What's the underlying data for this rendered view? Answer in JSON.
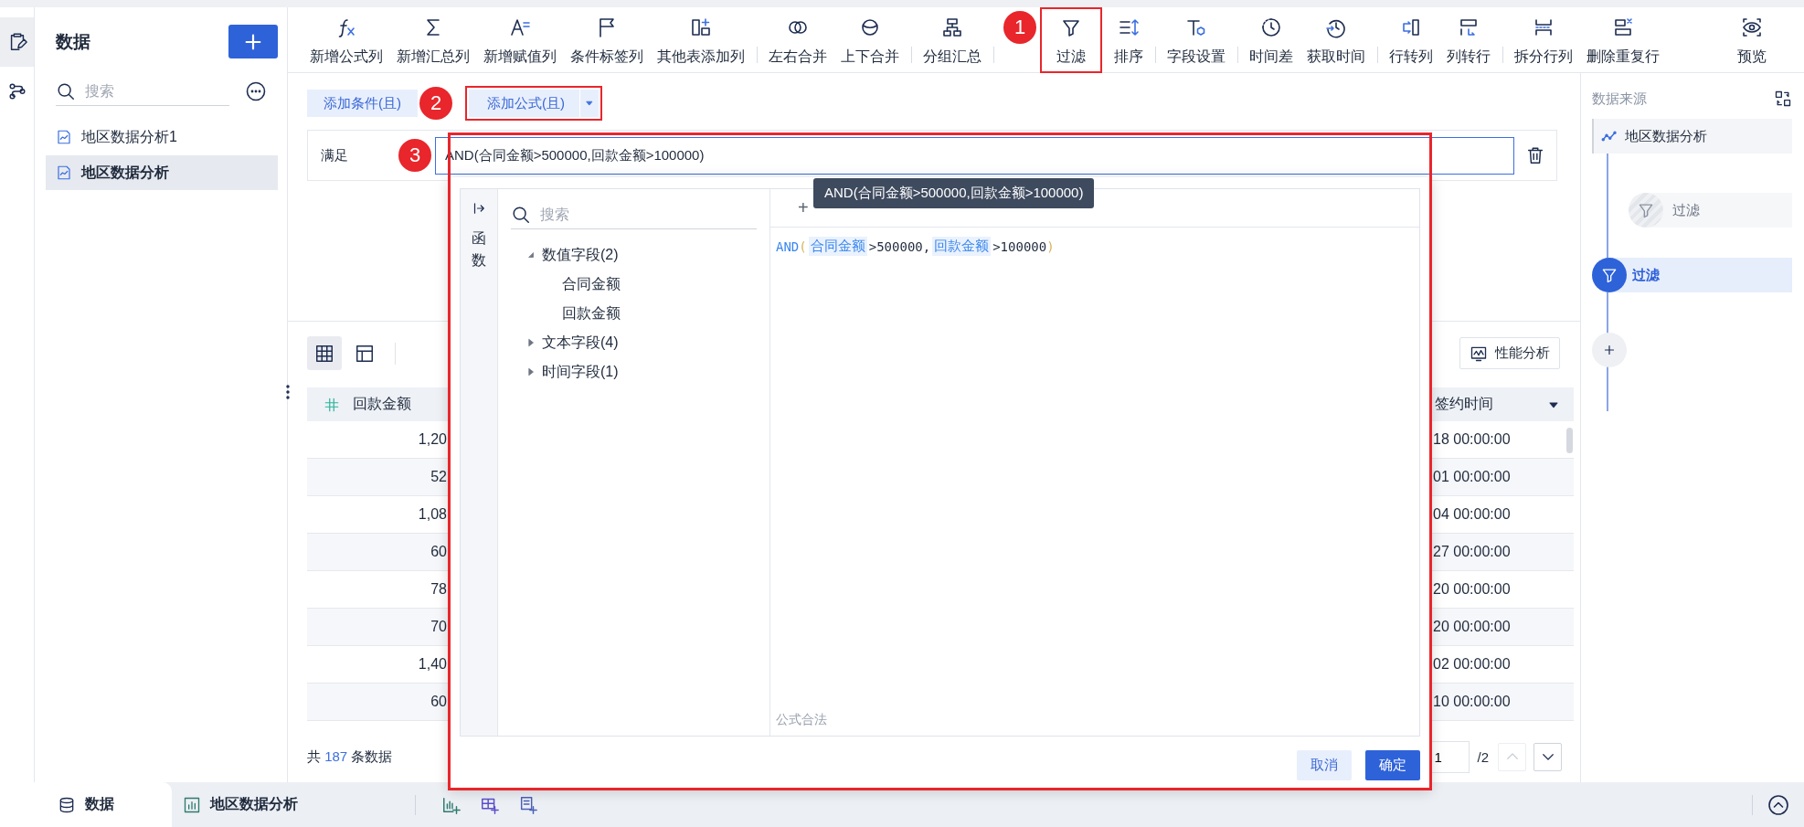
{
  "rail": [
    {
      "kind": "edit",
      "selected": true
    },
    {
      "kind": "flow",
      "selected": false
    }
  ],
  "data_panel": {
    "title": "数据",
    "search": {
      "placeholder": "搜索"
    },
    "items": [
      {
        "label": "地区数据分析1",
        "selected": false
      },
      {
        "label": "地区数据分析",
        "selected": true
      }
    ]
  },
  "toolbar": {
    "groups": [
      {
        "items": [
          {
            "kind": "formula",
            "label": "新增公式列"
          },
          {
            "kind": "sum",
            "label": "新增汇总列"
          },
          {
            "kind": "assign",
            "label": "新增赋值列"
          },
          {
            "kind": "tag",
            "label": "条件标签列"
          },
          {
            "kind": "join",
            "label": "其他表添加列"
          }
        ]
      },
      {
        "items": [
          {
            "kind": "merge-lr",
            "label": "左右合并"
          },
          {
            "kind": "merge-ud",
            "label": "上下合并"
          }
        ]
      },
      {
        "items": [
          {
            "kind": "group",
            "label": "分组汇总"
          }
        ]
      },
      {
        "items": [
          {
            "kind": "filter",
            "label": "过滤",
            "boxed": true,
            "callout": "1"
          },
          {
            "kind": "sort",
            "label": "排序"
          }
        ]
      },
      {
        "items": [
          {
            "kind": "field",
            "label": "字段设置"
          }
        ]
      },
      {
        "items": [
          {
            "kind": "timediff",
            "label": "时间差"
          },
          {
            "kind": "gettime",
            "label": "获取时间"
          }
        ]
      },
      {
        "items": [
          {
            "kind": "row2col",
            "label": "行转列"
          },
          {
            "kind": "col2row",
            "label": "列转行"
          }
        ]
      },
      {
        "items": [
          {
            "kind": "split",
            "label": "拆分行列"
          },
          {
            "kind": "dedupe",
            "label": "删除重复行"
          }
        ]
      },
      {
        "items": [
          {
            "kind": "preview",
            "label": "预览"
          }
        ]
      }
    ]
  },
  "conditions": {
    "add_condition": "添加条件(且)",
    "add_formula": {
      "label": "添加公式(且)",
      "boxed": true,
      "callout": "2"
    }
  },
  "filter_row": {
    "label": "满足",
    "formula": "AND(合同金额>500000,回款金额>100000)",
    "callout": "3"
  },
  "formula_popup": {
    "boxed": true,
    "side_tab": "函数",
    "search": {
      "placeholder": "搜索"
    },
    "tree": [
      {
        "label": "数值字段(2)",
        "expanded": true,
        "children": [
          {
            "label": "合同金额"
          },
          {
            "label": "回款金额"
          }
        ]
      },
      {
        "label": "文本字段(4)",
        "expanded": false
      },
      {
        "label": "时间字段(1)",
        "expanded": false
      }
    ],
    "operators": [
      "+"
    ],
    "expression": [
      {
        "kind": "func",
        "text": "AND"
      },
      {
        "kind": "paren",
        "text": "("
      },
      {
        "kind": "field",
        "text": "合同金额"
      },
      {
        "kind": "plain",
        "text": ">500000,"
      },
      {
        "kind": "field",
        "text": "回款金额"
      },
      {
        "kind": "plain",
        "text": ">100000"
      },
      {
        "kind": "paren",
        "text": ")"
      }
    ],
    "status": "公式合法",
    "buttons": [
      {
        "kind": "secondary",
        "label": "取消"
      },
      {
        "kind": "primary",
        "label": "确定"
      }
    ]
  },
  "tooltip": {
    "text": "AND(合同金额>500000,回款金额>100000)"
  },
  "table_tools": {
    "views": [
      {
        "kind": "grid",
        "selected": true
      },
      {
        "kind": "layout",
        "selected": false
      }
    ],
    "perf_button": "性能分析"
  },
  "table": {
    "columns": [
      {
        "kind": "number",
        "label": "回款金额"
      },
      {
        "kind": "date",
        "label": "签约时间"
      }
    ],
    "rows": [
      [
        "1,20",
        "18 00:00:00"
      ],
      [
        "52",
        "01 00:00:00"
      ],
      [
        "1,08",
        "04 00:00:00"
      ],
      [
        "60",
        "27 00:00:00"
      ],
      [
        "78",
        "20 00:00:00"
      ],
      [
        "70",
        "20 00:00:00"
      ],
      [
        "1,40",
        "02 00:00:00"
      ],
      [
        "60",
        "10 00:00:00"
      ]
    ]
  },
  "footer": {
    "prefix": "共",
    "count": "187",
    "suffix": "条数据"
  },
  "pagination": {
    "page": "1",
    "total": "/2",
    "prev_disabled": true
  },
  "right_panel": {
    "title": "数据来源",
    "steps": [
      {
        "kind": "source",
        "label": "地区数据分析",
        "selected": false
      },
      {
        "kind": "filter",
        "label": "过滤",
        "selected": false,
        "pending": true
      },
      {
        "kind": "filter",
        "label": "过滤",
        "selected": true,
        "pending": false
      }
    ]
  },
  "bottom_bar": {
    "tabs": [
      {
        "kind": "data",
        "label": "数据",
        "selected": true
      },
      {
        "kind": "sheet",
        "label": "地区数据分析",
        "selected": false
      }
    ],
    "actions": [
      {
        "kind": "chart"
      },
      {
        "kind": "table"
      },
      {
        "kind": "list"
      }
    ]
  }
}
